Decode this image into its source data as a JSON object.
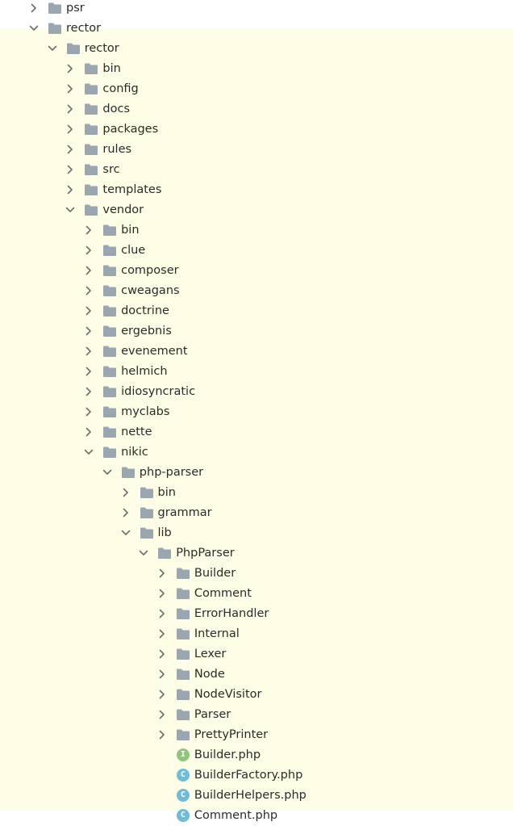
{
  "tree": {
    "selected_range_color": "#fefee6",
    "folder_color": "#9aa7b0",
    "chevron_color": "#6e6e6e",
    "items": [
      {
        "label": "psr",
        "level": 1,
        "type": "folder",
        "state": "collapsed"
      },
      {
        "label": "rector",
        "level": 1,
        "type": "folder",
        "state": "expanded"
      },
      {
        "label": "rector",
        "level": 2,
        "type": "folder",
        "state": "expanded"
      },
      {
        "label": "bin",
        "level": 3,
        "type": "folder",
        "state": "collapsed"
      },
      {
        "label": "config",
        "level": 3,
        "type": "folder",
        "state": "collapsed"
      },
      {
        "label": "docs",
        "level": 3,
        "type": "folder",
        "state": "collapsed"
      },
      {
        "label": "packages",
        "level": 3,
        "type": "folder",
        "state": "collapsed"
      },
      {
        "label": "rules",
        "level": 3,
        "type": "folder",
        "state": "collapsed"
      },
      {
        "label": "src",
        "level": 3,
        "type": "folder",
        "state": "collapsed"
      },
      {
        "label": "templates",
        "level": 3,
        "type": "folder",
        "state": "collapsed"
      },
      {
        "label": "vendor",
        "level": 3,
        "type": "folder",
        "state": "expanded"
      },
      {
        "label": "bin",
        "level": 4,
        "type": "folder",
        "state": "collapsed"
      },
      {
        "label": "clue",
        "level": 4,
        "type": "folder",
        "state": "collapsed"
      },
      {
        "label": "composer",
        "level": 4,
        "type": "folder",
        "state": "collapsed"
      },
      {
        "label": "cweagans",
        "level": 4,
        "type": "folder",
        "state": "collapsed"
      },
      {
        "label": "doctrine",
        "level": 4,
        "type": "folder",
        "state": "collapsed"
      },
      {
        "label": "ergebnis",
        "level": 4,
        "type": "folder",
        "state": "collapsed"
      },
      {
        "label": "evenement",
        "level": 4,
        "type": "folder",
        "state": "collapsed"
      },
      {
        "label": "helmich",
        "level": 4,
        "type": "folder",
        "state": "collapsed"
      },
      {
        "label": "idiosyncratic",
        "level": 4,
        "type": "folder",
        "state": "collapsed"
      },
      {
        "label": "myclabs",
        "level": 4,
        "type": "folder",
        "state": "collapsed"
      },
      {
        "label": "nette",
        "level": 4,
        "type": "folder",
        "state": "collapsed"
      },
      {
        "label": "nikic",
        "level": 4,
        "type": "folder",
        "state": "expanded"
      },
      {
        "label": "php-parser",
        "level": 5,
        "type": "folder",
        "state": "expanded"
      },
      {
        "label": "bin",
        "level": 6,
        "type": "folder",
        "state": "collapsed"
      },
      {
        "label": "grammar",
        "level": 6,
        "type": "folder",
        "state": "collapsed"
      },
      {
        "label": "lib",
        "level": 6,
        "type": "folder",
        "state": "expanded"
      },
      {
        "label": "PhpParser",
        "level": 7,
        "type": "folder",
        "state": "expanded"
      },
      {
        "label": "Builder",
        "level": 8,
        "type": "folder",
        "state": "collapsed"
      },
      {
        "label": "Comment",
        "level": 8,
        "type": "folder",
        "state": "collapsed"
      },
      {
        "label": "ErrorHandler",
        "level": 8,
        "type": "folder",
        "state": "collapsed"
      },
      {
        "label": "Internal",
        "level": 8,
        "type": "folder",
        "state": "collapsed"
      },
      {
        "label": "Lexer",
        "level": 8,
        "type": "folder",
        "state": "collapsed"
      },
      {
        "label": "Node",
        "level": 8,
        "type": "folder",
        "state": "collapsed"
      },
      {
        "label": "NodeVisitor",
        "level": 8,
        "type": "folder",
        "state": "collapsed"
      },
      {
        "label": "Parser",
        "level": 8,
        "type": "folder",
        "state": "collapsed"
      },
      {
        "label": "PrettyPrinter",
        "level": 8,
        "type": "folder",
        "state": "collapsed"
      },
      {
        "label": "Builder.php",
        "level": 8,
        "type": "interface",
        "letter": "I",
        "color": "#8ec77a"
      },
      {
        "label": "BuilderFactory.php",
        "level": 8,
        "type": "class",
        "letter": "C",
        "color": "#6fbcd9"
      },
      {
        "label": "BuilderHelpers.php",
        "level": 8,
        "type": "class",
        "letter": "C",
        "color": "#6fbcd9",
        "variant": "abstract"
      },
      {
        "label": "Comment.php",
        "level": 8,
        "type": "class",
        "letter": "C",
        "color": "#6fbcd9"
      }
    ]
  }
}
